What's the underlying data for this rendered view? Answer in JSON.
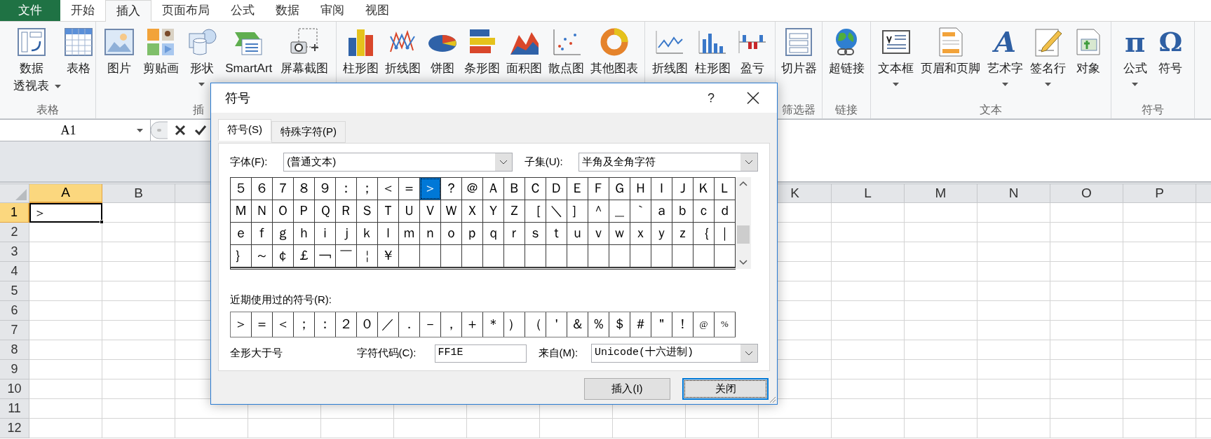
{
  "ribbon_tabs": [
    {
      "label": "文件",
      "kind": "file",
      "selected": false
    },
    {
      "label": "开始",
      "kind": "tab",
      "selected": false
    },
    {
      "label": "插入",
      "kind": "tab",
      "selected": true
    },
    {
      "label": "页面布局",
      "kind": "tab",
      "selected": false
    },
    {
      "label": "公式",
      "kind": "tab",
      "selected": false
    },
    {
      "label": "数据",
      "kind": "tab",
      "selected": false
    },
    {
      "label": "审阅",
      "kind": "tab",
      "selected": false
    },
    {
      "label": "视图",
      "kind": "tab",
      "selected": false
    }
  ],
  "ribbon_groups": [
    {
      "label": "表格",
      "items": [
        {
          "label": [
            "数据",
            "透视表"
          ],
          "dropdown": true
        },
        {
          "label": [
            "表格"
          ],
          "dropdown": false
        }
      ]
    },
    {
      "label": "插",
      "items": [
        {
          "label": [
            "图片"
          ],
          "dropdown": false
        },
        {
          "label": [
            "剪贴画"
          ],
          "dropdown": false
        },
        {
          "label": [
            "形状"
          ],
          "dropdown": true
        },
        {
          "label": [
            "SmartArt"
          ],
          "dropdown": false
        },
        {
          "label": [
            "屏幕截图"
          ],
          "dropdown": false
        }
      ]
    },
    {
      "items": [
        {
          "label": [
            "柱形图"
          ],
          "dropdown": false
        },
        {
          "label": [
            "折线图"
          ],
          "dropdown": false
        },
        {
          "label": [
            "饼图"
          ],
          "dropdown": false
        },
        {
          "label": [
            "条形图"
          ],
          "dropdown": false
        },
        {
          "label": [
            "面积图"
          ],
          "dropdown": false
        },
        {
          "label": [
            "散点图"
          ],
          "dropdown": false
        },
        {
          "label": [
            "其他图表"
          ],
          "dropdown": false
        }
      ]
    },
    {
      "items": [
        {
          "label": [
            "折线图"
          ],
          "dropdown": false
        },
        {
          "label": [
            "柱形图"
          ],
          "dropdown": false
        },
        {
          "label": [
            "盈亏"
          ],
          "dropdown": false
        }
      ]
    },
    {
      "label": "筛选器",
      "items": [
        {
          "label": [
            "切片器"
          ],
          "dropdown": false
        }
      ]
    },
    {
      "label": "链接",
      "items": [
        {
          "label": [
            "超链接"
          ],
          "dropdown": false
        }
      ]
    },
    {
      "label": "文本",
      "items": [
        {
          "label": [
            "文本框"
          ],
          "dropdown": true
        },
        {
          "label": [
            "页眉和页脚"
          ],
          "dropdown": false
        },
        {
          "label": [
            "艺术字"
          ],
          "dropdown": true,
          "glyph": "A"
        },
        {
          "label": [
            "签名行"
          ],
          "dropdown": true
        },
        {
          "label": [
            "对象"
          ],
          "dropdown": false
        }
      ]
    },
    {
      "label": "符号",
      "items": [
        {
          "label": [
            "公式"
          ],
          "dropdown": true,
          "glyph": "π"
        },
        {
          "label": [
            "符号"
          ],
          "dropdown": false,
          "glyph": "Ω"
        }
      ]
    }
  ],
  "formula_bar": {
    "name_box": "A1"
  },
  "sheet": {
    "columns": [
      {
        "label": "A",
        "selected": true
      },
      {
        "label": "B",
        "selected": false
      },
      {
        "label": "K",
        "selected": false
      },
      {
        "label": "L",
        "selected": false
      },
      {
        "label": "M",
        "selected": false
      },
      {
        "label": "N",
        "selected": false
      },
      {
        "label": "O",
        "selected": false
      },
      {
        "label": "P",
        "selected": false
      }
    ],
    "rows": [
      {
        "label": "1",
        "selected": true,
        "cells": [
          {
            "value": "＞",
            "selected": true
          }
        ]
      },
      {
        "label": "2",
        "selected": false
      },
      {
        "label": "3",
        "selected": false
      },
      {
        "label": "4",
        "selected": false
      },
      {
        "label": "5",
        "selected": false
      },
      {
        "label": "6",
        "selected": false
      },
      {
        "label": "7",
        "selected": false
      },
      {
        "label": "8",
        "selected": false
      },
      {
        "label": "9",
        "selected": false
      },
      {
        "label": "10",
        "selected": false
      },
      {
        "label": "11",
        "selected": false
      },
      {
        "label": "12",
        "selected": false
      }
    ]
  },
  "dialog": {
    "title": "符号",
    "help": "?",
    "tabs": [
      {
        "label": "符号(S)",
        "selected": true
      },
      {
        "label": "特殊字符(P)",
        "selected": false
      }
    ],
    "font": {
      "label": "字体(F):",
      "value": "(普通文本)"
    },
    "subset": {
      "label": "子集(U):",
      "value": "半角及全角字符"
    },
    "symbols": [
      [
        {
          "ch": "５",
          "selected": false
        },
        {
          "ch": "６",
          "selected": false
        },
        {
          "ch": "７",
          "selected": false
        },
        {
          "ch": "８",
          "selected": false
        },
        {
          "ch": "９",
          "selected": false
        },
        {
          "ch": "：",
          "selected": false
        },
        {
          "ch": "；",
          "selected": false
        },
        {
          "ch": "＜",
          "selected": false
        },
        {
          "ch": "＝",
          "selected": false
        },
        {
          "ch": "＞",
          "selected": true
        },
        {
          "ch": "？",
          "selected": false
        },
        {
          "ch": "＠",
          "selected": false
        },
        {
          "ch": "Ａ",
          "selected": false
        },
        {
          "ch": "Ｂ",
          "selected": false
        },
        {
          "ch": "Ｃ",
          "selected": false
        },
        {
          "ch": "Ｄ",
          "selected": false
        },
        {
          "ch": "Ｅ",
          "selected": false
        },
        {
          "ch": "Ｆ",
          "selected": false
        },
        {
          "ch": "Ｇ",
          "selected": false
        },
        {
          "ch": "Ｈ",
          "selected": false
        },
        {
          "ch": "Ｉ",
          "selected": false
        },
        {
          "ch": "Ｊ",
          "selected": false
        },
        {
          "ch": "Ｋ",
          "selected": false
        },
        {
          "ch": "Ｌ",
          "selected": false
        }
      ],
      [
        {
          "ch": "Ｍ",
          "selected": false
        },
        {
          "ch": "Ｎ",
          "selected": false
        },
        {
          "ch": "Ｏ",
          "selected": false
        },
        {
          "ch": "Ｐ",
          "selected": false
        },
        {
          "ch": "Ｑ",
          "selected": false
        },
        {
          "ch": "Ｒ",
          "selected": false
        },
        {
          "ch": "Ｓ",
          "selected": false
        },
        {
          "ch": "Ｔ",
          "selected": false
        },
        {
          "ch": "Ｕ",
          "selected": false
        },
        {
          "ch": "Ｖ",
          "selected": false
        },
        {
          "ch": "Ｗ",
          "selected": false
        },
        {
          "ch": "Ｘ",
          "selected": false
        },
        {
          "ch": "Ｙ",
          "selected": false
        },
        {
          "ch": "Ｚ",
          "selected": false
        },
        {
          "ch": "［",
          "selected": false
        },
        {
          "ch": "＼",
          "selected": false
        },
        {
          "ch": "］",
          "selected": false
        },
        {
          "ch": "＾",
          "selected": false
        },
        {
          "ch": "＿",
          "selected": false
        },
        {
          "ch": "｀",
          "selected": false
        },
        {
          "ch": "ａ",
          "selected": false
        },
        {
          "ch": "ｂ",
          "selected": false
        },
        {
          "ch": "ｃ",
          "selected": false
        },
        {
          "ch": "ｄ",
          "selected": false
        }
      ],
      [
        {
          "ch": "ｅ",
          "selected": false
        },
        {
          "ch": "ｆ",
          "selected": false
        },
        {
          "ch": "ｇ",
          "selected": false
        },
        {
          "ch": "ｈ",
          "selected": false
        },
        {
          "ch": "ｉ",
          "selected": false
        },
        {
          "ch": "ｊ",
          "selected": false
        },
        {
          "ch": "ｋ",
          "selected": false
        },
        {
          "ch": "ｌ",
          "selected": false
        },
        {
          "ch": "ｍ",
          "selected": false
        },
        {
          "ch": "ｎ",
          "selected": false
        },
        {
          "ch": "ｏ",
          "selected": false
        },
        {
          "ch": "ｐ",
          "selected": false
        },
        {
          "ch": "ｑ",
          "selected": false
        },
        {
          "ch": "ｒ",
          "selected": false
        },
        {
          "ch": "ｓ",
          "selected": false
        },
        {
          "ch": "ｔ",
          "selected": false
        },
        {
          "ch": "ｕ",
          "selected": false
        },
        {
          "ch": "ｖ",
          "selected": false
        },
        {
          "ch": "ｗ",
          "selected": false
        },
        {
          "ch": "ｘ",
          "selected": false
        },
        {
          "ch": "ｙ",
          "selected": false
        },
        {
          "ch": "ｚ",
          "selected": false
        },
        {
          "ch": "｛",
          "selected": false
        },
        {
          "ch": "｜",
          "selected": false
        }
      ],
      [
        {
          "ch": "｝",
          "selected": false
        },
        {
          "ch": "～",
          "selected": false
        },
        {
          "ch": "￠",
          "selected": false
        },
        {
          "ch": "￡",
          "selected": false
        },
        {
          "ch": "￢",
          "selected": false
        },
        {
          "ch": "￣",
          "selected": false
        },
        {
          "ch": "￤",
          "selected": false
        },
        {
          "ch": "￥",
          "selected": false
        }
      ]
    ],
    "recent_label": "近期使用过的符号(R):",
    "recent": [
      {
        "ch": "＞",
        "selected": false
      },
      {
        "ch": "＝",
        "selected": false
      },
      {
        "ch": "＜",
        "selected": false
      },
      {
        "ch": "；",
        "selected": false
      },
      {
        "ch": "：",
        "selected": false
      },
      {
        "ch": "２",
        "selected": false
      },
      {
        "ch": "０",
        "selected": false
      },
      {
        "ch": "／",
        "selected": false
      },
      {
        "ch": "．",
        "selected": false
      },
      {
        "ch": "－",
        "selected": false
      },
      {
        "ch": "，",
        "selected": false
      },
      {
        "ch": "＋",
        "selected": false
      },
      {
        "ch": "＊",
        "selected": false
      },
      {
        "ch": "）",
        "selected": false
      },
      {
        "ch": "（",
        "selected": false
      },
      {
        "ch": "＇",
        "selected": false
      },
      {
        "ch": "＆",
        "selected": false
      },
      {
        "ch": "％",
        "selected": false
      },
      {
        "ch": "＄",
        "selected": false
      },
      {
        "ch": "＃",
        "selected": false
      },
      {
        "ch": "＂",
        "selected": false
      },
      {
        "ch": "！",
        "selected": false
      },
      {
        "ch": "@",
        "selected": false
      },
      {
        "ch": "%",
        "selected": false
      }
    ],
    "char_name": "全形大于号",
    "char_code": {
      "label": "字符代码(C):",
      "value": "FF1E"
    },
    "from": {
      "label": "来自(M):",
      "value": "Unicode(十六进制)"
    },
    "buttons": [
      {
        "label": "插入(I)",
        "default": false
      },
      {
        "label": "关闭",
        "default": true
      }
    ]
  }
}
